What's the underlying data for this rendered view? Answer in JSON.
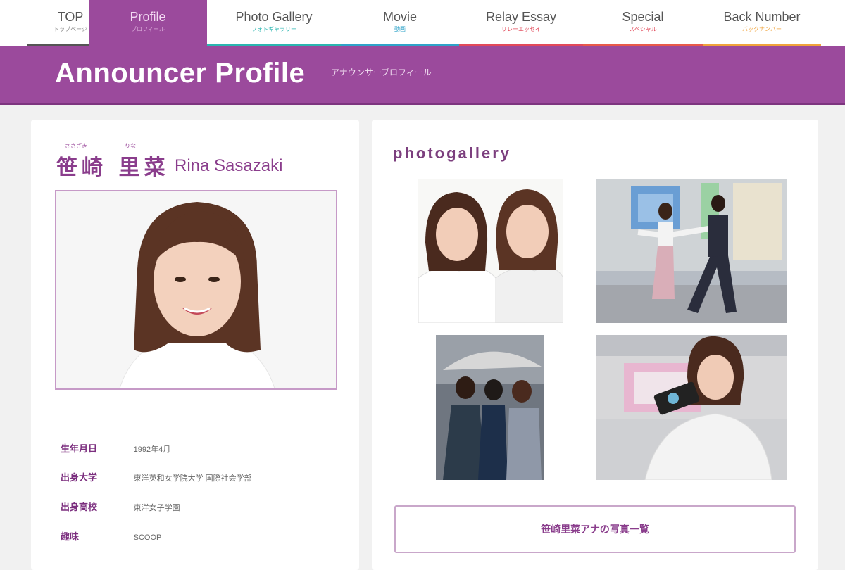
{
  "nav": {
    "tabs": [
      {
        "label": "TOP",
        "sub": "トップページ",
        "color": "#555555"
      },
      {
        "label": "Profile",
        "sub": "プロフィール",
        "color": "#9b4a9c"
      },
      {
        "label": "Photo Gallery",
        "sub": "フォトギャラリー",
        "color": "#2bb6b0"
      },
      {
        "label": "Movie",
        "sub": "動画",
        "color": "#2fa3c9"
      },
      {
        "label": "Relay Essay",
        "sub": "リレーエッセイ",
        "color": "#e24a5a"
      },
      {
        "label": "Special",
        "sub": "スペシャル",
        "color": "#e24a5a"
      },
      {
        "label": "Back Number",
        "sub": "バックナンバー",
        "color": "#f0a33b"
      }
    ]
  },
  "header": {
    "title": "Announcer Profile",
    "subtitle": "アナウンサープロフィール"
  },
  "profile": {
    "name_jp": "笹崎 里菜",
    "ruby_family": "ささざき",
    "ruby_given": "りな",
    "name_en": "Rina Sasazaki",
    "info": [
      {
        "label": "生年月日",
        "value": "1992年4月"
      },
      {
        "label": "出身大学",
        "value": "東洋英和女学院大学 国際社会学部"
      },
      {
        "label": "出身高校",
        "value": "東洋女子学園"
      },
      {
        "label": "趣味",
        "value": "SCOOP"
      }
    ]
  },
  "gallery": {
    "title": "photogallery",
    "button_label": "笹崎里菜アナの写真一覧"
  },
  "colors": {
    "brand": "#9b4a9c",
    "brand_dark": "#7d357f"
  }
}
